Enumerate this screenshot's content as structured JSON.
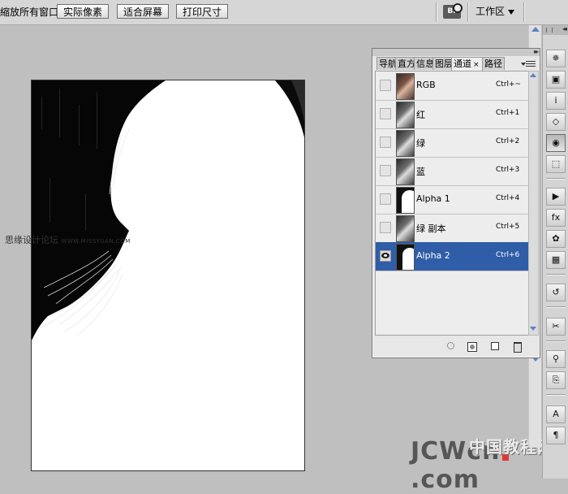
{
  "options_bar": {
    "label": "縮放所有窗口",
    "buttons": [
      {
        "name": "actual-pixels-button",
        "label": "实际像素"
      },
      {
        "name": "fit-screen-button",
        "label": "适合屏幕"
      },
      {
        "name": "print-size-button",
        "label": "打印尺寸"
      }
    ],
    "bridge_label": "Br",
    "workspace_label": "工作区"
  },
  "panel": {
    "tabs": [
      {
        "label": "导航"
      },
      {
        "label": "直方"
      },
      {
        "label": "信息"
      },
      {
        "label": "图层"
      },
      {
        "label": "通道",
        "active": true
      },
      {
        "label": "路径"
      }
    ],
    "tab_close": "×",
    "channels": [
      {
        "name": "RGB",
        "shortcut": "Ctrl+~",
        "thumb": "color",
        "visible": false,
        "selected": false
      },
      {
        "name": "红",
        "shortcut": "Ctrl+1",
        "thumb": "gray",
        "visible": false,
        "selected": false
      },
      {
        "name": "绿",
        "shortcut": "Ctrl+2",
        "thumb": "gray",
        "visible": false,
        "selected": false
      },
      {
        "name": "蓝",
        "shortcut": "Ctrl+3",
        "thumb": "gray",
        "visible": false,
        "selected": false
      },
      {
        "name": "Alpha 1",
        "shortcut": "Ctrl+4",
        "thumb": "mask",
        "visible": false,
        "selected": false
      },
      {
        "name": "绿 副本",
        "shortcut": "Ctrl+5",
        "thumb": "gray",
        "visible": false,
        "selected": false
      },
      {
        "name": "Alpha 2",
        "shortcut": "Ctrl+6",
        "thumb": "mask2",
        "visible": true,
        "selected": true
      }
    ],
    "footer_icons": [
      "load-channel-selection-icon",
      "save-selection-mask-icon",
      "new-channel-icon",
      "delete-channel-icon"
    ]
  },
  "toolbar": {
    "icons": [
      "compass-icon",
      "image-icon",
      "info-icon",
      "layers-icon",
      "channels-icon",
      "transform-icon",
      "play-icon",
      "fx-icon",
      "palette-icon",
      "swatches-icon",
      "history-icon",
      "tools-icon",
      "clone-source-icon",
      "stamp-icon",
      "character-icon",
      "paragraph-icon"
    ],
    "glyphs": [
      "✵",
      "▣",
      "i",
      "◇",
      "◉",
      "⬚",
      "▶",
      "fx",
      "✿",
      "▦",
      "↺",
      "✂",
      "⚲",
      "⎘",
      "A",
      "¶"
    ],
    "active_index": 4
  },
  "watermarks": {
    "left_cn": "思缘设计论坛",
    "left_url": "WWW.MISSYUAN.COM",
    "bottom_logo_a": "JCW",
    "bottom_logo_b": "cn",
    "bottom_logo_c": ".com",
    "bottom_cn": "中国教程网"
  }
}
